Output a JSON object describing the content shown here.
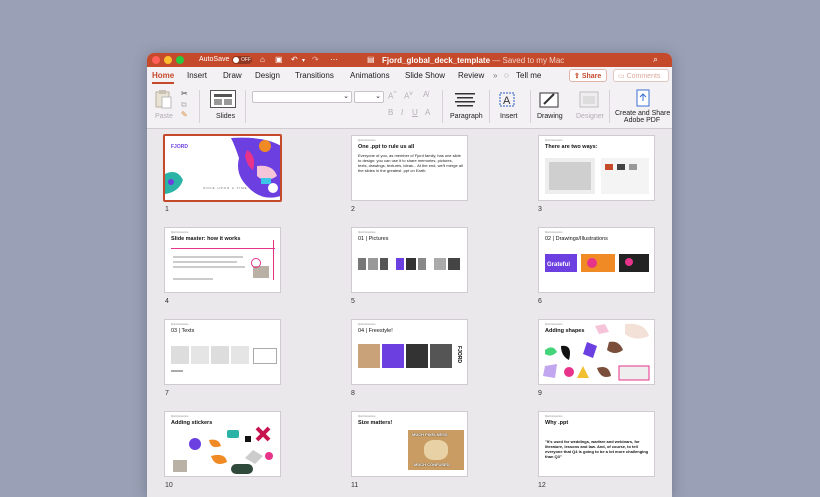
{
  "window": {
    "autosave_label": "AutoSave",
    "autosave_state": "OFF",
    "file_name": "Fjord_global_deck_template",
    "saved_status": " — Saved to my Mac"
  },
  "menu": {
    "tabs": [
      "Home",
      "Insert",
      "Draw",
      "Design",
      "Transitions",
      "Animations",
      "Slide Show",
      "Review"
    ],
    "tell_me": "Tell me",
    "share": "Share",
    "comments": "Comments"
  },
  "ribbon": {
    "paste": "Paste",
    "slides": "Slides",
    "paragraph": "Paragraph",
    "insert": "Insert",
    "drawing": "Drawing",
    "designer": "Designer",
    "create_pdf_line1": "Create and Share",
    "create_pdf_line2": "Adobe PDF"
  },
  "slides": [
    {
      "number": "1",
      "logo": "FJORD",
      "tagline": "ONCE UPON A TIME..."
    },
    {
      "number": "2",
      "tiny": "Fjord Accenture",
      "title": "One .ppt to rule us all",
      "body": "Everyone of you, as member of Fjord family, has one slide to design: you can use it to share memories, pictures, texts, drawings, textures, ideas... At the end, we'll merge all the slides in the greatest .ppt on Earth."
    },
    {
      "number": "3",
      "tiny": "Fjord Accenture",
      "title": "There are two ways:"
    },
    {
      "number": "4",
      "tiny": "Fjord Accenture",
      "title": "Slide master: how it works"
    },
    {
      "number": "5",
      "tiny": "Fjord Accenture",
      "title": "01 | Pictures"
    },
    {
      "number": "6",
      "tiny": "Fjord Accenture",
      "title": "02 | Drawings/Illustrations",
      "word": "Grateful"
    },
    {
      "number": "7",
      "tiny": "Fjord Accenture",
      "title": "03 | Texts"
    },
    {
      "number": "8",
      "tiny": "Fjord Accenture",
      "title": "04 | Freestyle!",
      "side": "FJORD"
    },
    {
      "number": "9",
      "tiny": "Fjord Accenture",
      "title": "Adding shapes"
    },
    {
      "number": "10",
      "tiny": "Fjord Accenture",
      "title": "Adding stickers"
    },
    {
      "number": "11",
      "tiny": "Fjord Accenture",
      "title": "Size matters!",
      "meme_top": "MUCH PIXELNESS",
      "meme_bottom": "MUCH CONFUSED"
    },
    {
      "number": "12",
      "tiny": "Fjord Accenture",
      "title": "Why .ppt",
      "quote": "\"It's used for weddings, warfare and webinars, for literature, lessons and law. And, of course, to tell everyone that Q4 is going to be a lot more challenging than Q3\""
    }
  ],
  "colors": {
    "accent": "#c54a2c",
    "purple": "#6b3fe0",
    "pink": "#e8338a",
    "orange": "#f08a24"
  }
}
